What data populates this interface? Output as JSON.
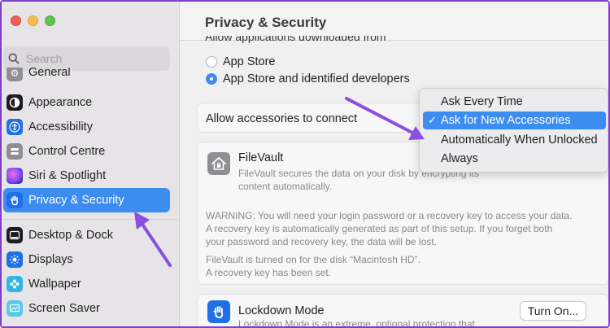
{
  "sidebar": {
    "search_placeholder": "Search",
    "items": [
      {
        "label": "General",
        "icon": "gear-icon",
        "color": "#8e8e93"
      },
      {
        "label": "Appearance",
        "icon": "appearance-icon",
        "color": "#1c1c1e"
      },
      {
        "label": "Accessibility",
        "icon": "accessibility-icon",
        "color": "#1f6fe5"
      },
      {
        "label": "Control Centre",
        "icon": "control-centre-icon",
        "color": "#8e8e93"
      },
      {
        "label": "Siri & Spotlight",
        "icon": "siri-icon",
        "color": "#b04de0"
      },
      {
        "label": "Privacy & Security",
        "icon": "hand-icon",
        "color": "#1f6fe5",
        "active": true
      },
      {
        "label": "Desktop & Dock",
        "icon": "dock-icon",
        "color": "#1c1c1e"
      },
      {
        "label": "Displays",
        "icon": "displays-icon",
        "color": "#1f6fe5"
      },
      {
        "label": "Wallpaper",
        "icon": "wallpaper-icon",
        "color": "#33b4e5"
      },
      {
        "label": "Screen Saver",
        "icon": "screen-saver-icon",
        "color": "#5ac8e8"
      }
    ]
  },
  "main": {
    "title": "Privacy & Security",
    "downloads_label": "Allow applications downloaded from",
    "radio_app_store": "App Store",
    "radio_identified": "App Store and identified developers",
    "accessories_label": "Allow accessories to connect",
    "filevault_title": "FileVault",
    "filevault_desc_1": "FileVault secures the data on your disk by encrypting its",
    "filevault_desc_2": "content automatically.",
    "warning_1": "WARNING: You will need your login password or a recovery key to access your data.",
    "warning_2": "A recovery key is automatically generated as part of this setup. If you forget both",
    "warning_3": "your password and recovery key, the data will be lost.",
    "status_1": "FileVault is turned on for the disk “Macintosh HD”.",
    "status_2": "A recovery key has been set.",
    "lockdown_title": "Lockdown Mode",
    "lockdown_desc": "Lockdown Mode is an extreme, optional protection that",
    "turn_on_label": "Turn On..."
  },
  "menu": {
    "items": [
      "Ask Every Time",
      "Ask for New Accessories",
      "Automatically When Unlocked",
      "Always"
    ],
    "selected_index": 1
  },
  "colors": {
    "accent": "#3d8cf0",
    "annotation_arrow": "#8a4fe0"
  }
}
